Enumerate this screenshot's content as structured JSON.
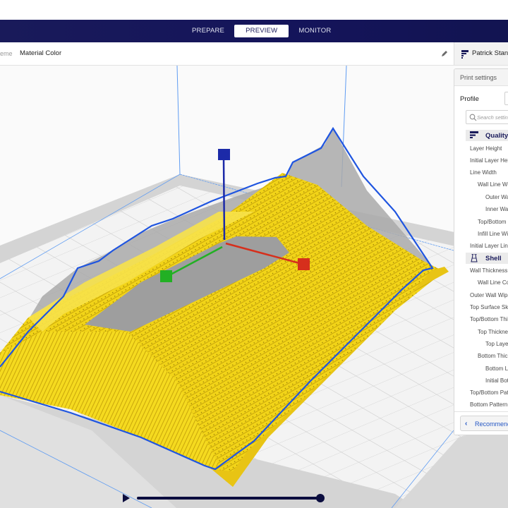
{
  "app": {
    "stages": [
      {
        "label": "PREPARE",
        "active": false
      },
      {
        "label": "PREVIEW",
        "active": true
      },
      {
        "label": "MONITOR",
        "active": false
      }
    ]
  },
  "color_scheme": {
    "label": "Color scheme",
    "label_visible": "eme",
    "value": "Material Color"
  },
  "printer": {
    "name": "Patrick Stand"
  },
  "print_settings": {
    "title": "Print settings",
    "profile_label": "Profile",
    "search_placeholder": "Search settings",
    "categories": [
      {
        "name": "Quality",
        "icon": "quality-icon",
        "settings": [
          {
            "label": "Layer Height",
            "depth": 0
          },
          {
            "label": "Initial Layer Height",
            "depth": 0
          },
          {
            "label": "Line Width",
            "depth": 0
          },
          {
            "label": "Wall Line Width",
            "depth": 1
          },
          {
            "label": "Outer Wall Line Width",
            "depth": 2
          },
          {
            "label": "Inner Wall(s) Line Width",
            "depth": 2
          },
          {
            "label": "Top/Bottom Line Width",
            "depth": 1
          },
          {
            "label": "Infill Line Width",
            "depth": 1
          },
          {
            "label": "Initial Layer Line Width",
            "depth": 0
          }
        ]
      },
      {
        "name": "Shell",
        "icon": "shell-icon",
        "settings": [
          {
            "label": "Wall Thickness",
            "depth": 0
          },
          {
            "label": "Wall Line Count",
            "depth": 1
          },
          {
            "label": "Outer Wall Wipe Distance",
            "depth": 0
          },
          {
            "label": "Top Surface Skin Layers",
            "depth": 0
          },
          {
            "label": "Top/Bottom Thickness",
            "depth": 0
          },
          {
            "label": "Top Thickness",
            "depth": 1
          },
          {
            "label": "Top Layers",
            "depth": 2
          },
          {
            "label": "Bottom Thickness",
            "depth": 1
          },
          {
            "label": "Bottom Layers",
            "depth": 2
          },
          {
            "label": "Initial Bottom Layers",
            "depth": 2
          },
          {
            "label": "Top/Bottom Pattern",
            "depth": 0
          },
          {
            "label": "Bottom Pattern Initial Layer",
            "depth": 0
          }
        ]
      }
    ],
    "footer_button": "Recommended"
  },
  "layer_view": {
    "progress": 1.0
  },
  "colors": {
    "navbar": "#191a5a",
    "accent": "#2557c4",
    "model": "#f2d418",
    "axis_x": "#d62f1c",
    "axis_y": "#22b024",
    "axis_z": "#1c2aa8"
  }
}
